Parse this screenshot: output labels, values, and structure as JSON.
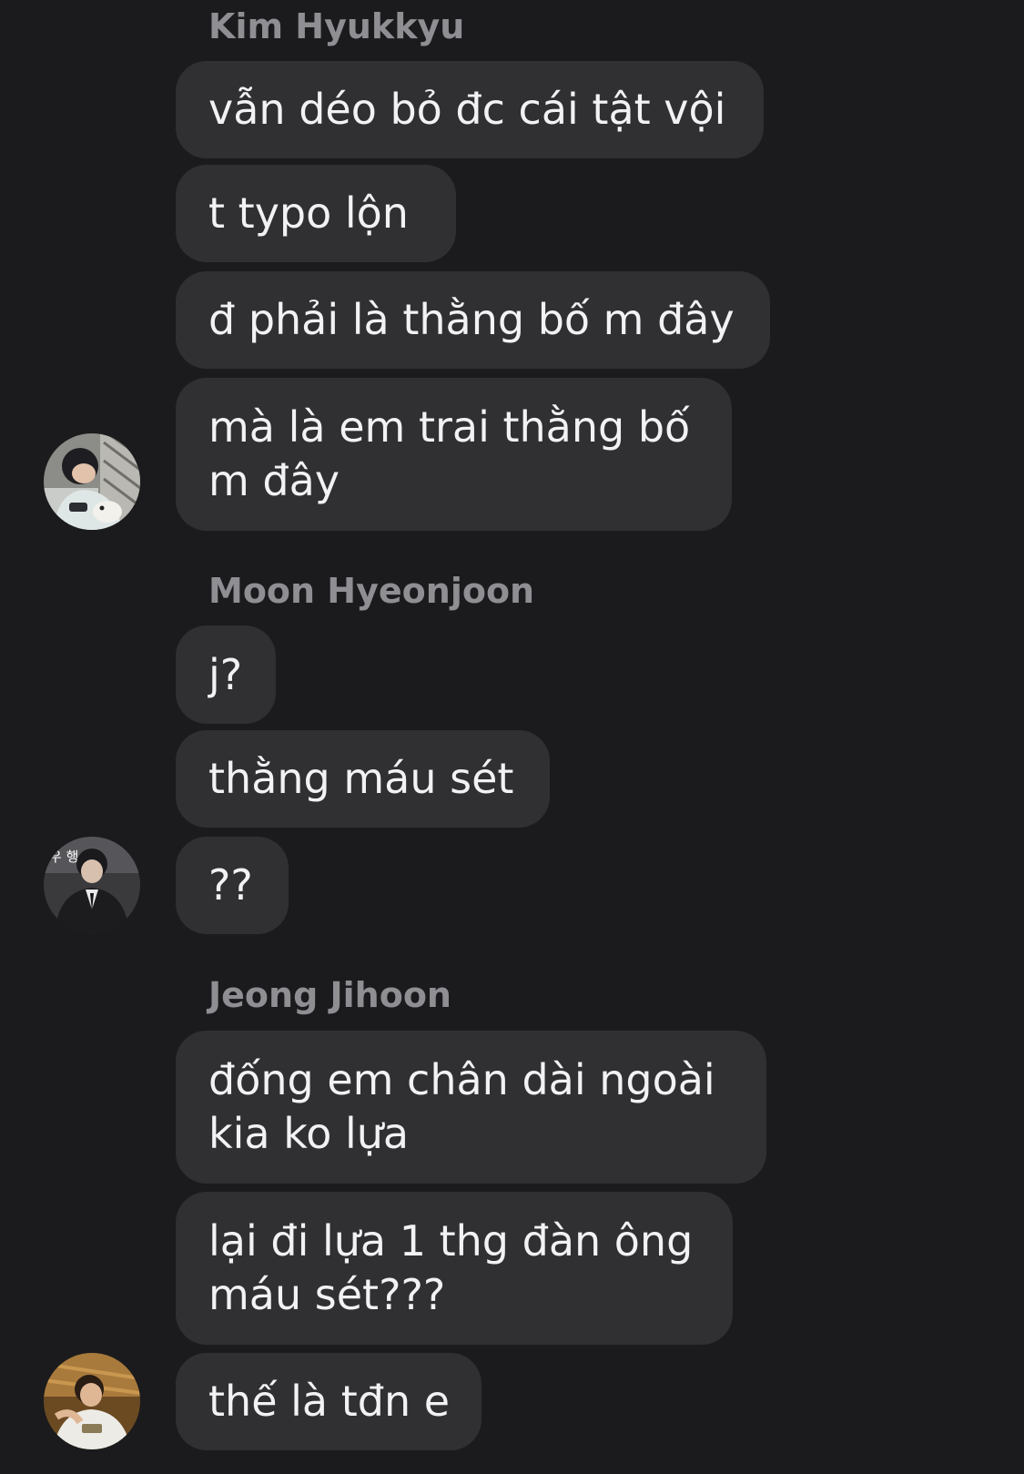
{
  "conversation": {
    "groups": [
      {
        "sender": "Kim Hyukkyu",
        "messages": [
          {
            "lines": [
              "vẫn déo bỏ đc cái tật vội"
            ]
          },
          {
            "lines": [
              "t typo lộn"
            ]
          },
          {
            "lines": [
              "đ phải là thằng bố m đây"
            ]
          },
          {
            "lines": [
              "mà là em trai thằng bố",
              "m đây"
            ]
          }
        ],
        "avatar_icon": "user-photo-avatar"
      },
      {
        "sender": "Moon Hyeonjoon",
        "messages": [
          {
            "lines": [
              "j?"
            ]
          },
          {
            "lines": [
              "thằng máu sét"
            ]
          },
          {
            "lines": [
              "??"
            ]
          }
        ],
        "avatar_icon": "user-photo-avatar",
        "avatar_overlay_text": "우  행"
      },
      {
        "sender": "Jeong Jihoon",
        "messages": [
          {
            "lines": [
              "đống em chân dài ngoài",
              "kia ko lựa"
            ]
          },
          {
            "lines": [
              "lại đi lựa 1 thg đàn ông",
              "máu sét???"
            ]
          },
          {
            "lines": [
              "thế là tđn e"
            ]
          }
        ],
        "avatar_icon": "user-photo-avatar"
      }
    ]
  },
  "colors": {
    "background": "#1b1b1d",
    "bubble": "#303033",
    "sender_name": "#8e8e93",
    "message_text": "#f2f2f4"
  }
}
